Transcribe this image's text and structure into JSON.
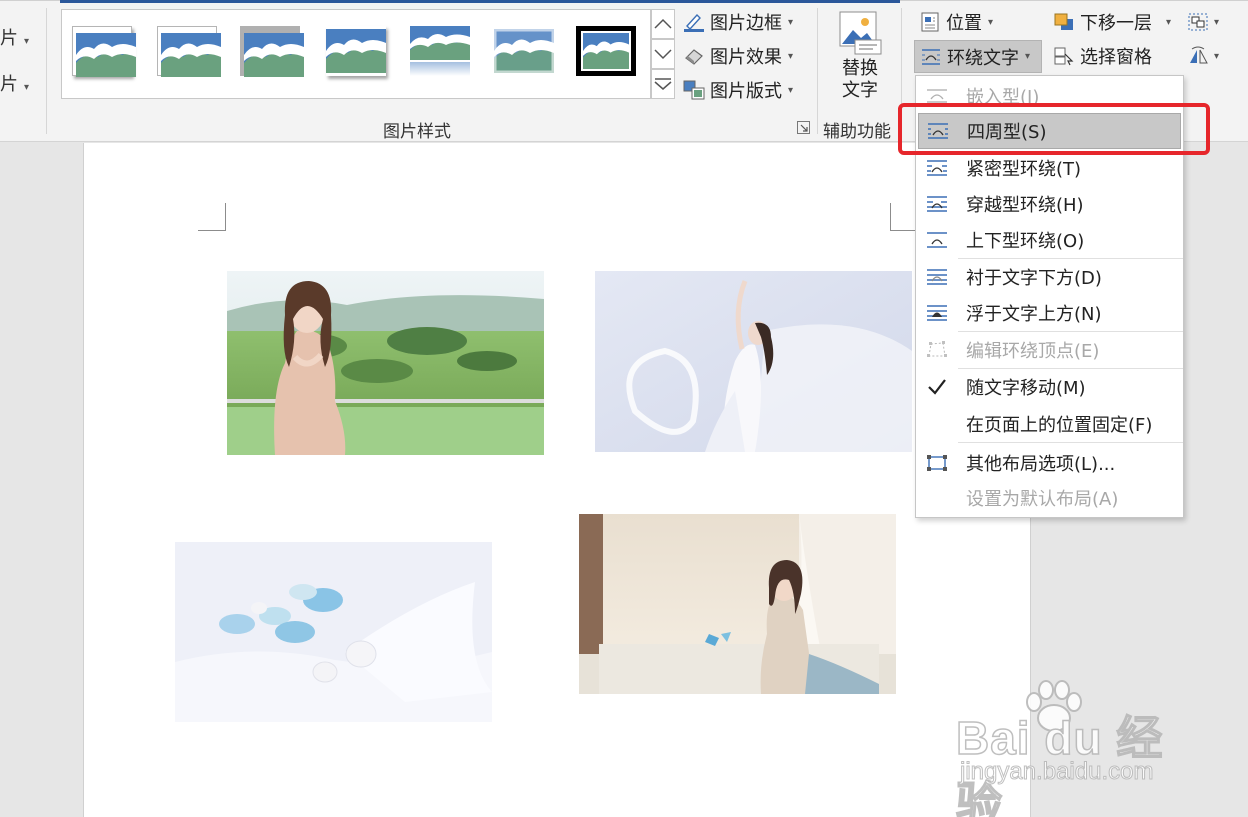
{
  "ribbon": {
    "left_fragments": [
      "片",
      "片"
    ],
    "picture_styles_group_label": "图片样式",
    "picture_border_label": "图片边框",
    "picture_effects_label": "图片效果",
    "picture_layout_label": "图片版式",
    "accessibility_group_label": "辅助功能",
    "alt_text_line1": "替换",
    "alt_text_line2": "文字",
    "position_label": "位置",
    "wrap_text_label": "环绕文字",
    "send_backward_label": "下移一层",
    "selection_pane_label": "选择窗格"
  },
  "wrap_menu": {
    "items": [
      {
        "label": "嵌入型(I)",
        "icon": "wrap-inline-icon",
        "state": "disabled"
      },
      {
        "label": "四周型(S)",
        "icon": "wrap-square-icon",
        "state": "highlighted"
      },
      {
        "label": "紧密型环绕(T)",
        "icon": "wrap-tight-icon",
        "state": "normal"
      },
      {
        "label": "穿越型环绕(H)",
        "icon": "wrap-through-icon",
        "state": "normal"
      },
      {
        "label": "上下型环绕(O)",
        "icon": "wrap-top-bottom-icon",
        "state": "normal"
      },
      {
        "label": "衬于文字下方(D)",
        "icon": "behind-text-icon",
        "state": "normal"
      },
      {
        "label": "浮于文字上方(N)",
        "icon": "in-front-of-text-icon",
        "state": "normal"
      },
      {
        "label": "编辑环绕顶点(E)",
        "icon": "edit-wrap-points-icon",
        "state": "disabled"
      },
      {
        "label": "随文字移动(M)",
        "icon": "checkmark-icon",
        "state": "checked"
      },
      {
        "label": "在页面上的位置固定(F)",
        "icon": "",
        "state": "normal"
      },
      {
        "label": "其他布局选项(L)...",
        "icon": "more-layout-icon",
        "state": "normal"
      },
      {
        "label": "设置为默认布局(A)",
        "icon": "",
        "state": "disabled"
      }
    ]
  },
  "watermark": {
    "main": "Bai du 经验",
    "sub": "jingyan.baidu.com"
  },
  "colors": {
    "ribbon_bg": "#f3f3f3",
    "highlight_bg": "#c8c8c8",
    "annotation_red": "#e6262b",
    "accent_blue": "#2b579a"
  }
}
